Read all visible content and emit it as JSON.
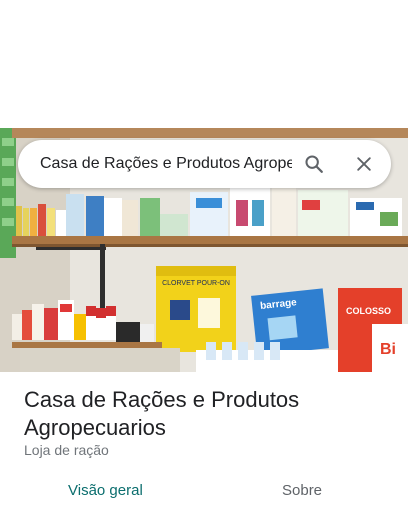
{
  "search": {
    "value": "Casa de Rações e Produtos Agropecuarios",
    "search_icon": "search-icon",
    "close_icon": "close-icon"
  },
  "place": {
    "title": "Casa de Rações e Produtos Agropecuarios",
    "category": "Loja de ração"
  },
  "tabs": [
    {
      "label": "Visão geral",
      "selected": true
    },
    {
      "label": "Sobre",
      "selected": false
    }
  ],
  "photo": {
    "box_front_label": "CLORVET POUR-ON",
    "box_side_label": "barrage",
    "box_right_label": "COLOSSO",
    "box_right_small": "Bi"
  },
  "colors": {
    "active_tab": "#0b6e6e",
    "inactive_tab": "#5f6368",
    "title": "#202124",
    "subtitle": "#70757a"
  }
}
